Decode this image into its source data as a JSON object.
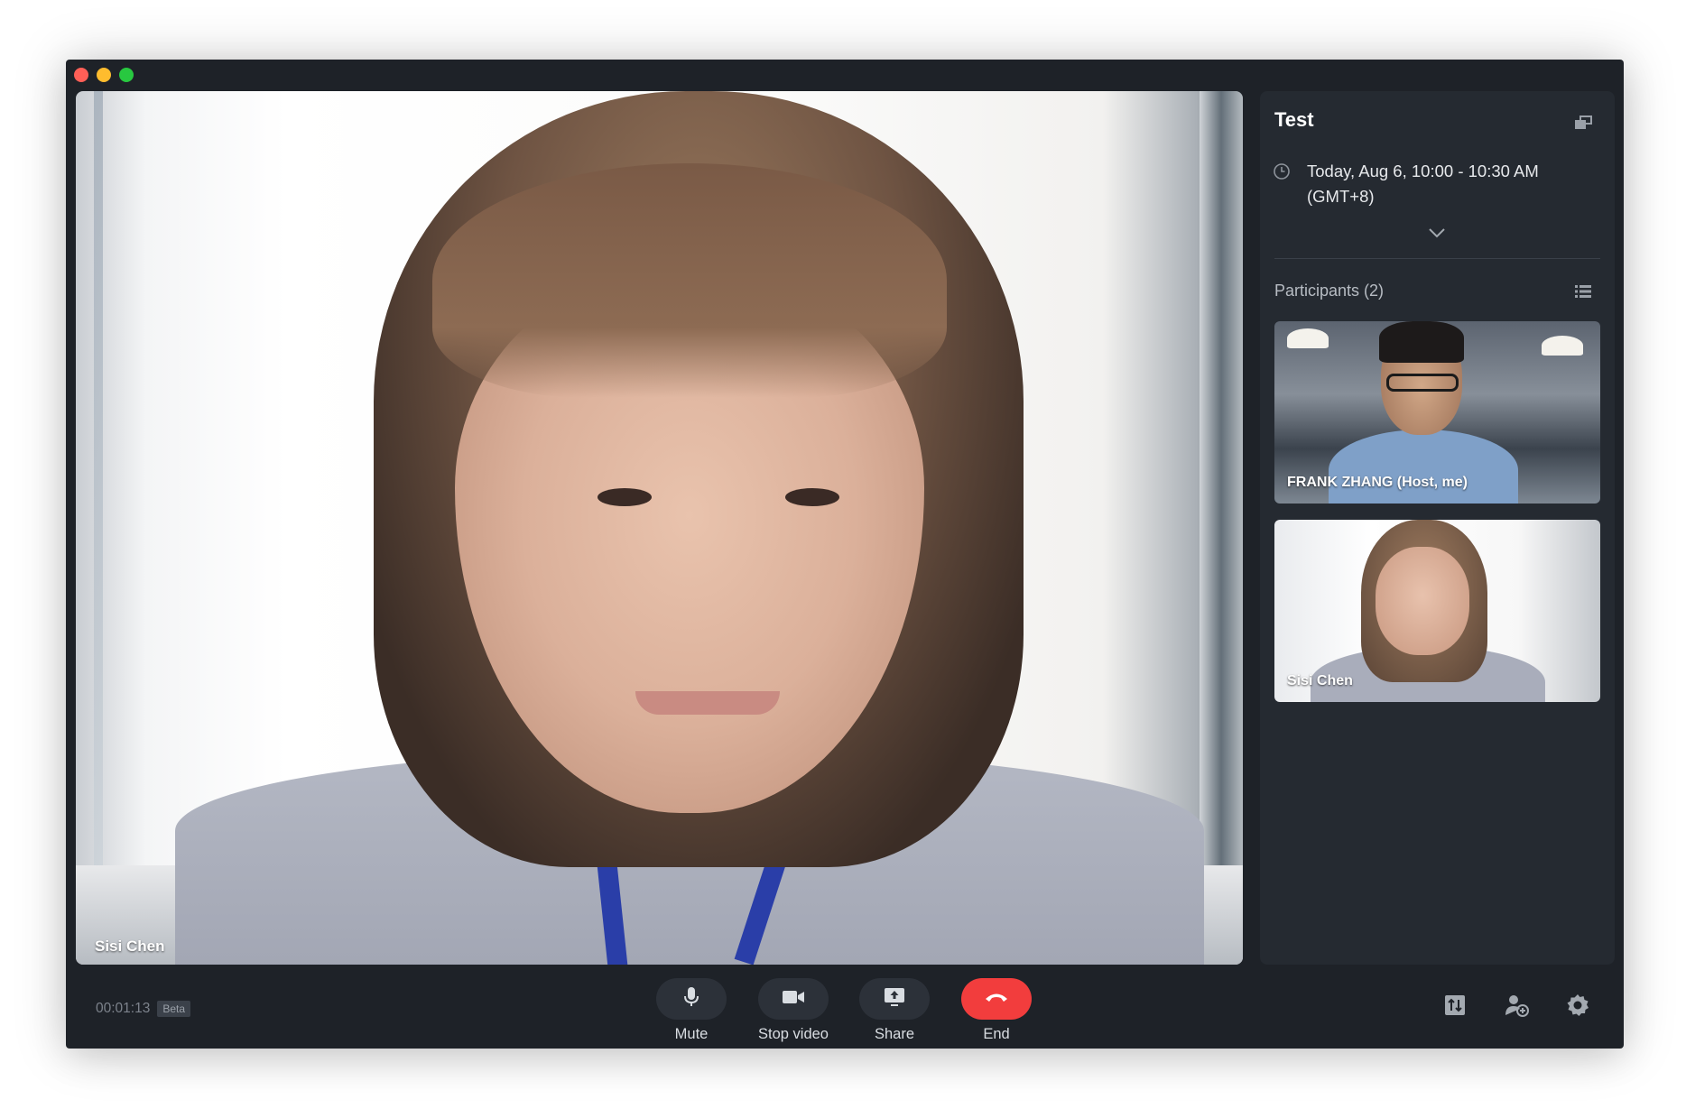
{
  "window": {
    "traffic_lights": [
      "close",
      "minimize",
      "zoom"
    ]
  },
  "main_video": {
    "participant_name": "Sisi Chen"
  },
  "sidebar": {
    "meeting_title": "Test",
    "schedule_line1": "Today, Aug 6, 10:00 - 10:30 AM",
    "schedule_line2": "(GMT+8)",
    "participants_label": "Participants (2)",
    "participants": [
      {
        "name": "FRANK ZHANG (Host, me)"
      },
      {
        "name": "Sisi Chen"
      }
    ]
  },
  "bottom_bar": {
    "timer": "00:01:13",
    "beta_badge": "Beta",
    "controls": {
      "mute": "Mute",
      "stop_video": "Stop video",
      "share": "Share",
      "end": "End"
    },
    "icons": [
      "layout-icon",
      "add-participant-icon",
      "settings-icon"
    ]
  },
  "colors": {
    "window_bg": "#1e2228",
    "sidebar_bg": "#252a31",
    "end_button": "#f23d3d",
    "control_pill": "#2c3139"
  }
}
